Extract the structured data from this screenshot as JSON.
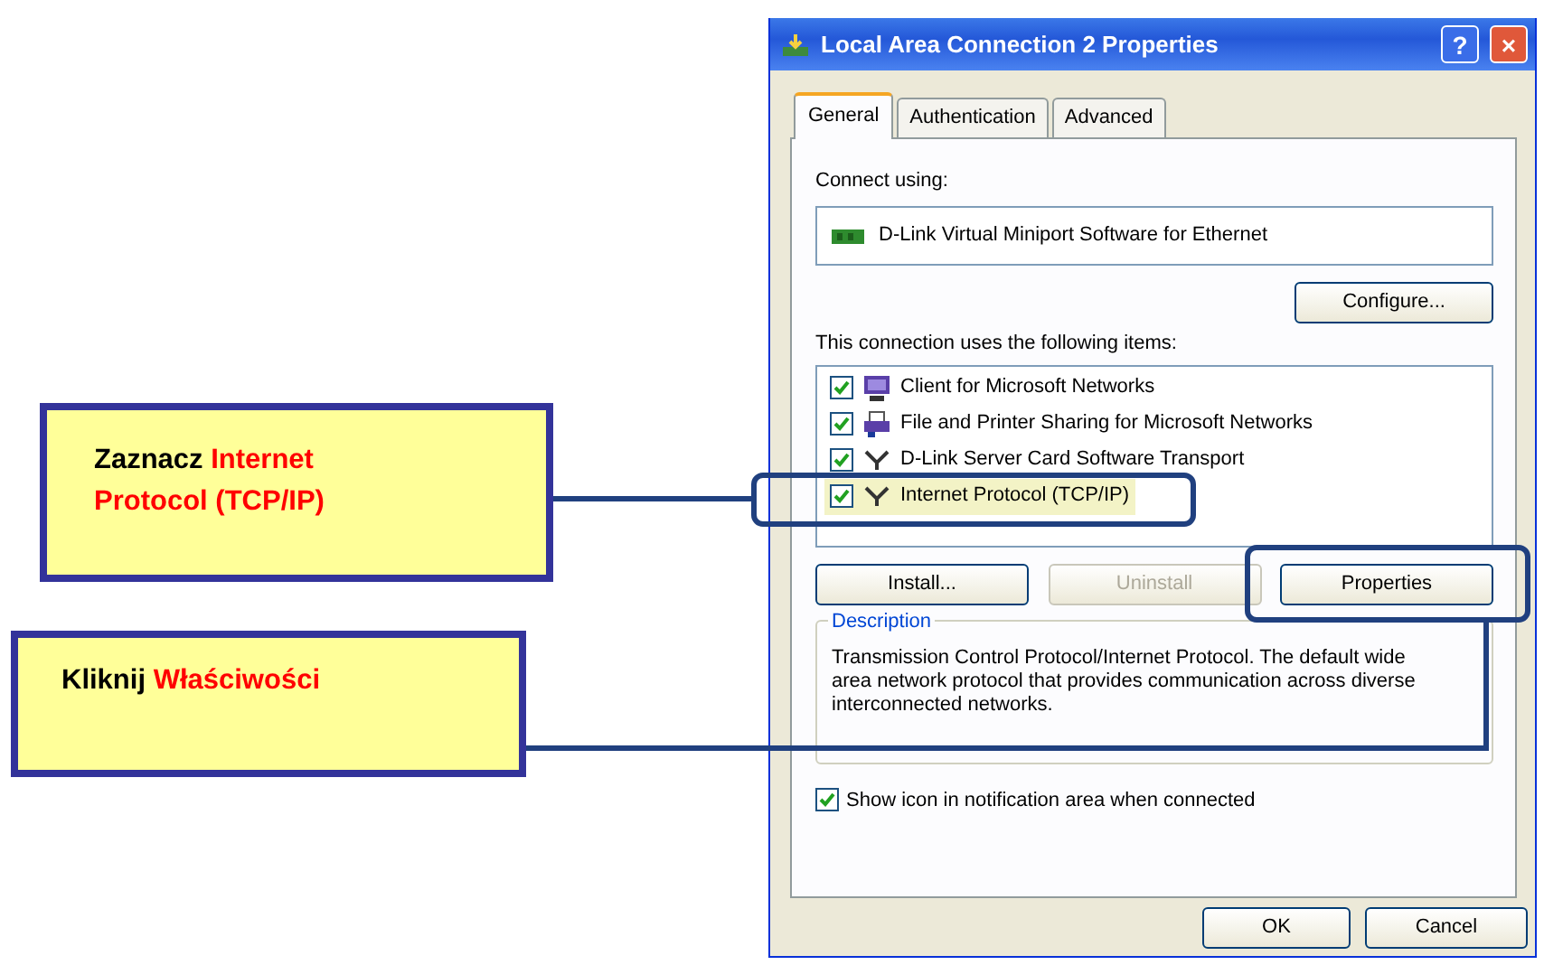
{
  "callouts": [
    {
      "text": "Zaznacz",
      "emphasis": "Internet Protocol (TCP/IP)"
    },
    {
      "text": "Kliknij",
      "emphasis": "Właściwości"
    }
  ],
  "window": {
    "title": "Local Area Connection 2 Properties",
    "help": "?",
    "close": "×"
  },
  "tabs": [
    {
      "label": "General",
      "selected": true
    },
    {
      "label": "Authentication",
      "selected": false
    },
    {
      "label": "Advanced",
      "selected": false
    }
  ],
  "connect_using": {
    "label": "Connect using:",
    "adapter": "D-Link Virtual Miniport Software for Ethernet",
    "button": "Configure..."
  },
  "items_label": "This connection uses the following items:",
  "items": [
    {
      "label": "Client for Microsoft Networks",
      "kind": "client",
      "checked": true,
      "selected": false
    },
    {
      "label": "File and Printer Sharing for Microsoft Networks",
      "kind": "service",
      "checked": true,
      "selected": false
    },
    {
      "label": "D-Link Server Card Software Transport",
      "kind": "protocol",
      "checked": true,
      "selected": false
    },
    {
      "label": "Internet Protocol (TCP/IP)",
      "kind": "protocol",
      "checked": true,
      "selected": true
    }
  ],
  "item_buttons": [
    {
      "label": "Install...",
      "disabled": false
    },
    {
      "label": "Uninstall",
      "disabled": true
    },
    {
      "label": "Properties",
      "disabled": false
    }
  ],
  "description": {
    "legend": "Description",
    "text": "Transmission Control Protocol/Internet Protocol. The default wide area network protocol that provides communication across diverse interconnected networks."
  },
  "show_icon": {
    "label": "Show icon in notification area when connected",
    "checked": true
  },
  "buttons": [
    "OK",
    "Cancel"
  ]
}
